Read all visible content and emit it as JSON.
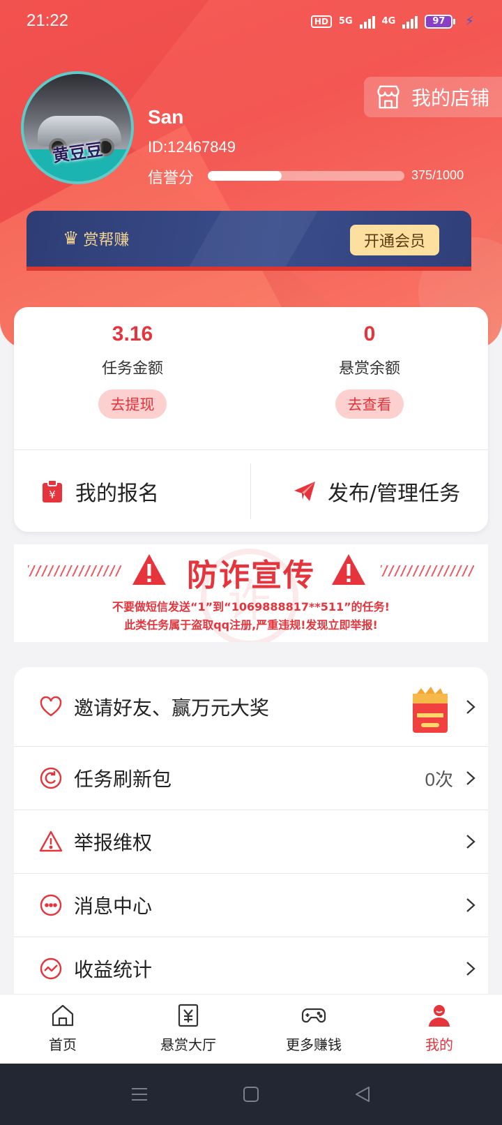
{
  "status": {
    "time": "21:22",
    "network": "5G",
    "network2": "4G",
    "hd": "HD",
    "battery": "97"
  },
  "header": {
    "shop_label": "我的店铺",
    "username": "San",
    "user_id": "ID:12467849",
    "credit_label": "信誉分",
    "credit_value": "375/1000",
    "credit_fraction": 0.375,
    "avatar_text": "黄豆豆"
  },
  "vip": {
    "title": "赏帮赚",
    "button": "开通会员"
  },
  "balance": {
    "task_amount": "3.16",
    "task_label": "任务金额",
    "task_button": "去提现",
    "reward_amount": "0",
    "reward_label": "悬赏余额",
    "reward_button": "去查看",
    "signup_label": "我的报名",
    "publish_label": "发布/管理任务"
  },
  "fraud": {
    "title": "防诈宣传",
    "line1": "不要做短信发送“1”到“1069888817**511”的任务!",
    "line2": "此类任务属于盗取qq注册,严重违规!发现立即举报!",
    "watermark": "诈"
  },
  "menu": [
    {
      "label": "邀请好友、赢万元大奖",
      "value": "",
      "icon": "heart-icon"
    },
    {
      "label": "任务刷新包",
      "value": "0次",
      "icon": "refresh-icon"
    },
    {
      "label": "举报维权",
      "value": "",
      "icon": "warning-icon"
    },
    {
      "label": "消息中心",
      "value": "",
      "icon": "message-icon"
    },
    {
      "label": "收益统计",
      "value": "",
      "icon": "chart-icon"
    }
  ],
  "nav": [
    {
      "label": "首页",
      "icon": "home-icon"
    },
    {
      "label": "悬赏大厅",
      "icon": "yuan-icon"
    },
    {
      "label": "更多赚钱",
      "icon": "gamepad-icon"
    },
    {
      "label": "我的",
      "icon": "user-icon"
    }
  ],
  "colors": {
    "primary": "#e5343b",
    "header": "#f2524f",
    "vip": "#2e3d74",
    "gold": "#f4d58f"
  }
}
